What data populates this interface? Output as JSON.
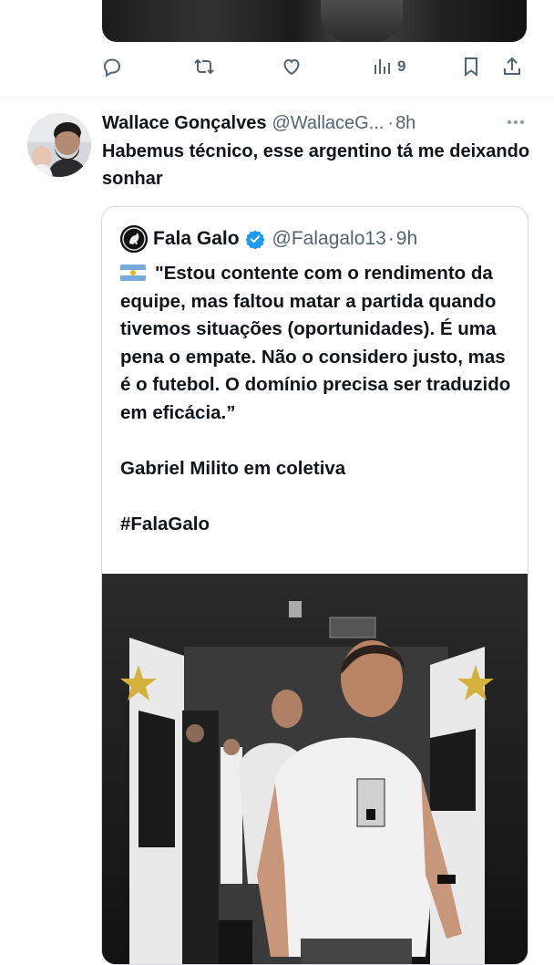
{
  "previous_tweet": {
    "views_count": "9"
  },
  "tweet": {
    "author_name": "Wallace Gonçalves",
    "author_handle": "@WallaceG...",
    "time": "8h",
    "text": "Habemus técnico, esse argentino tá me deixando sonhar"
  },
  "quoted_tweet": {
    "author_name": "Fala Galo",
    "author_handle": "@Falagalo13",
    "time": "9h",
    "text": "\"Estou contente com o rendimento da equipe, mas faltou matar a partida quando tivemos situações (oportunidades). É uma pena o empate. Não o considero justo, mas é o futebol. O domínio precisa ser traduzido em eficácia.”\n\nGabriel Milito em coletiva\n\n#FalaGalo",
    "flag_icon": "argentina-flag-icon"
  },
  "colors": {
    "text": "#0f1419",
    "secondary": "#536471",
    "verified": "#1d9bf0",
    "border": "#cfd9de"
  }
}
